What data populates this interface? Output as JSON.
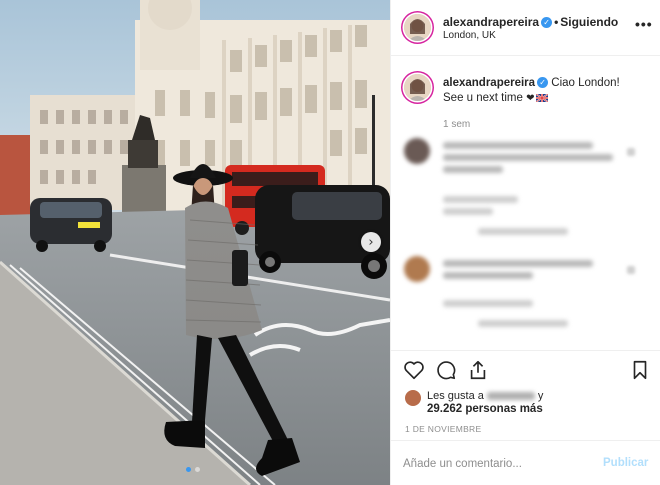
{
  "post": {
    "username": "alexandrapereira",
    "verified_icon": "verified-badge-icon",
    "follow_separator": "•",
    "follow_status": "Siguiendo",
    "location": "London, UK",
    "more_icon": "ellipsis-icon",
    "more_label": "•••"
  },
  "caption": {
    "username": "alexandrapereira",
    "text_line1": "Ciao London!",
    "text_line2": "See u next time",
    "emoji_heart": "❤",
    "flag_icon": "uk-flag-icon",
    "time": "1 sem"
  },
  "photo": {
    "next_icon": "chevron-right-icon",
    "next_label": "›",
    "carousel": {
      "count": 2,
      "active_index": 0
    }
  },
  "actions": {
    "like_icon": "heart-icon",
    "comment_icon": "comment-icon",
    "share_icon": "share-icon",
    "save_icon": "bookmark-icon",
    "likes_prefix": "Les gusta a",
    "likes_connector": "y",
    "likes_count": "29.262 personas más",
    "date": "1 DE NOVIEMBRE"
  },
  "comment_box": {
    "placeholder": "Añade un comentario...",
    "publish_label": "Publicar"
  },
  "colors": {
    "accent_blue": "#3897f0",
    "publish_disabled": "#b2dffc",
    "text": "#262626",
    "muted": "#8e8e8e",
    "border": "#efefef"
  }
}
